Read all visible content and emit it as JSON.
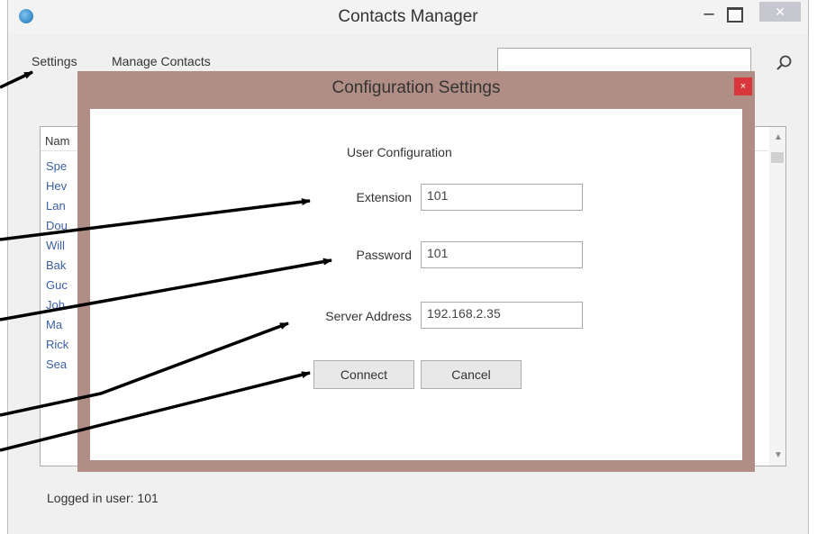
{
  "window": {
    "title": "Contacts Manager",
    "minimize_glyph": "–",
    "close_glyph": "✕"
  },
  "menu": {
    "items": [
      "Settings",
      "Manage Contacts"
    ]
  },
  "search": {
    "value": "",
    "icon": "search-icon"
  },
  "contacts": {
    "header": "Nam",
    "items": [
      "Spe",
      "Hev",
      "Lan",
      "Dou",
      "Will",
      "Bak",
      "Guc",
      "Joh",
      "Ma",
      "Rick",
      "Sea"
    ]
  },
  "status": "Logged in user: 101",
  "dialog": {
    "title": "Configuration Settings",
    "close_glyph": "×",
    "section_title": "User Configuration",
    "fields": [
      {
        "label": "Extension",
        "value": "101"
      },
      {
        "label": "Password",
        "value": "101"
      },
      {
        "label": "Server Address",
        "value": "192.168.2.35"
      }
    ],
    "connect_label": "Connect",
    "cancel_label": "Cancel"
  },
  "colors": {
    "dialog_frame": "#b08e86",
    "close_red": "#d8383c",
    "link_blue": "#3a5fa8"
  }
}
